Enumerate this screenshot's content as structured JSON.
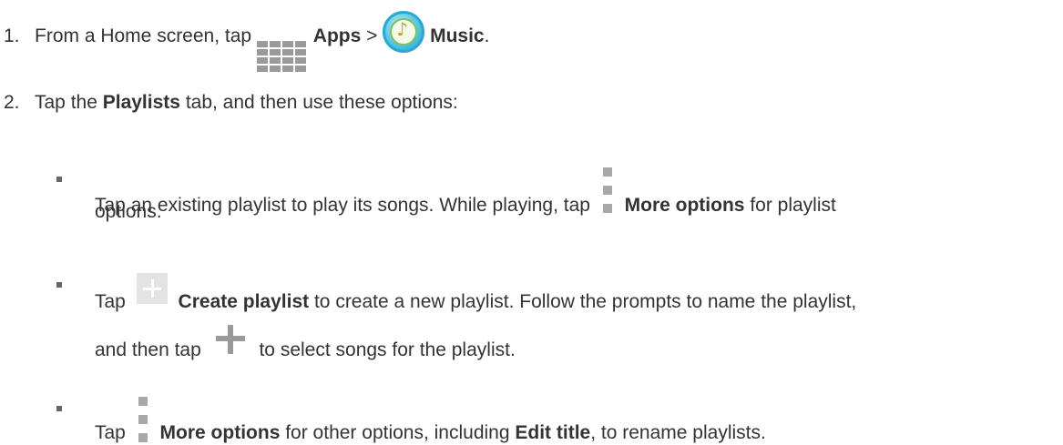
{
  "steps": [
    {
      "number": "1.",
      "text_before": "From a Home screen, tap",
      "apps_label": "Apps",
      "separator": ">",
      "music_label": "Music",
      "end": "."
    },
    {
      "number": "2.",
      "text_before": "Tap the",
      "tab_label": "Playlists",
      "text_after": "tab, and then use these options:"
    }
  ],
  "bullets": [
    {
      "text_before": "Tap an existing playlist to play its songs. While playing, tap",
      "bold": "More options",
      "text_after": "for playlist",
      "continuation": "options."
    },
    {
      "text_before": "Tap",
      "bold": "Create playlist",
      "text_after": "to create a new playlist. Follow the prompts to name the playlist,",
      "continuation_before": "and then tap",
      "continuation_after": "to select songs for the playlist."
    },
    {
      "text_before": "Tap",
      "bold": "More options",
      "text_mid": "for other options, including",
      "bold2": "Edit title",
      "text_after": ", to rename playlists."
    }
  ],
  "icons": {
    "apps": "apps-grid-icon",
    "music": "music-app-icon",
    "more": "more-options-icon",
    "create": "create-playlist-icon",
    "add": "add-plus-icon"
  }
}
